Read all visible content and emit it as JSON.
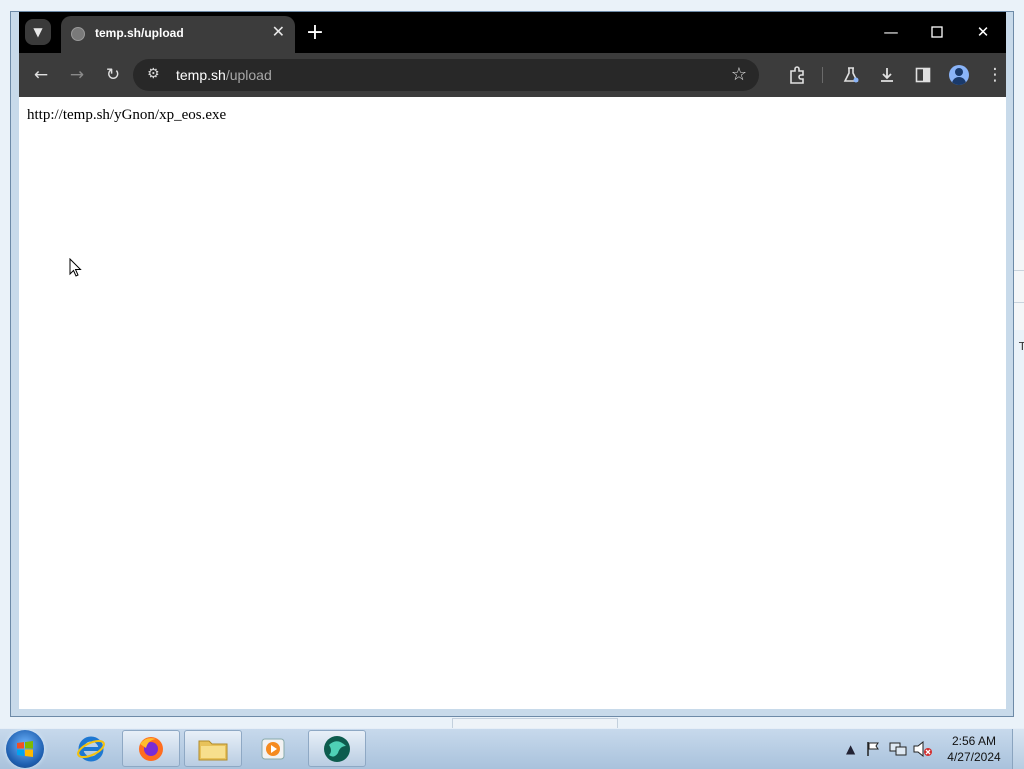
{
  "browser": {
    "tab": {
      "title": "temp.sh/upload"
    },
    "address_bar": {
      "domain": "temp.sh",
      "path": "/upload"
    }
  },
  "page": {
    "body_text": "http://temp.sh/yGnon/xp_eos.exe"
  },
  "background_window": {
    "partial_text": "T"
  },
  "taskbar": {
    "apps": [
      "internet-explorer",
      "firefox",
      "file-explorer",
      "media-player",
      "active-app"
    ],
    "clock": {
      "time": "2:56 AM",
      "date": "4/27/2024"
    }
  }
}
